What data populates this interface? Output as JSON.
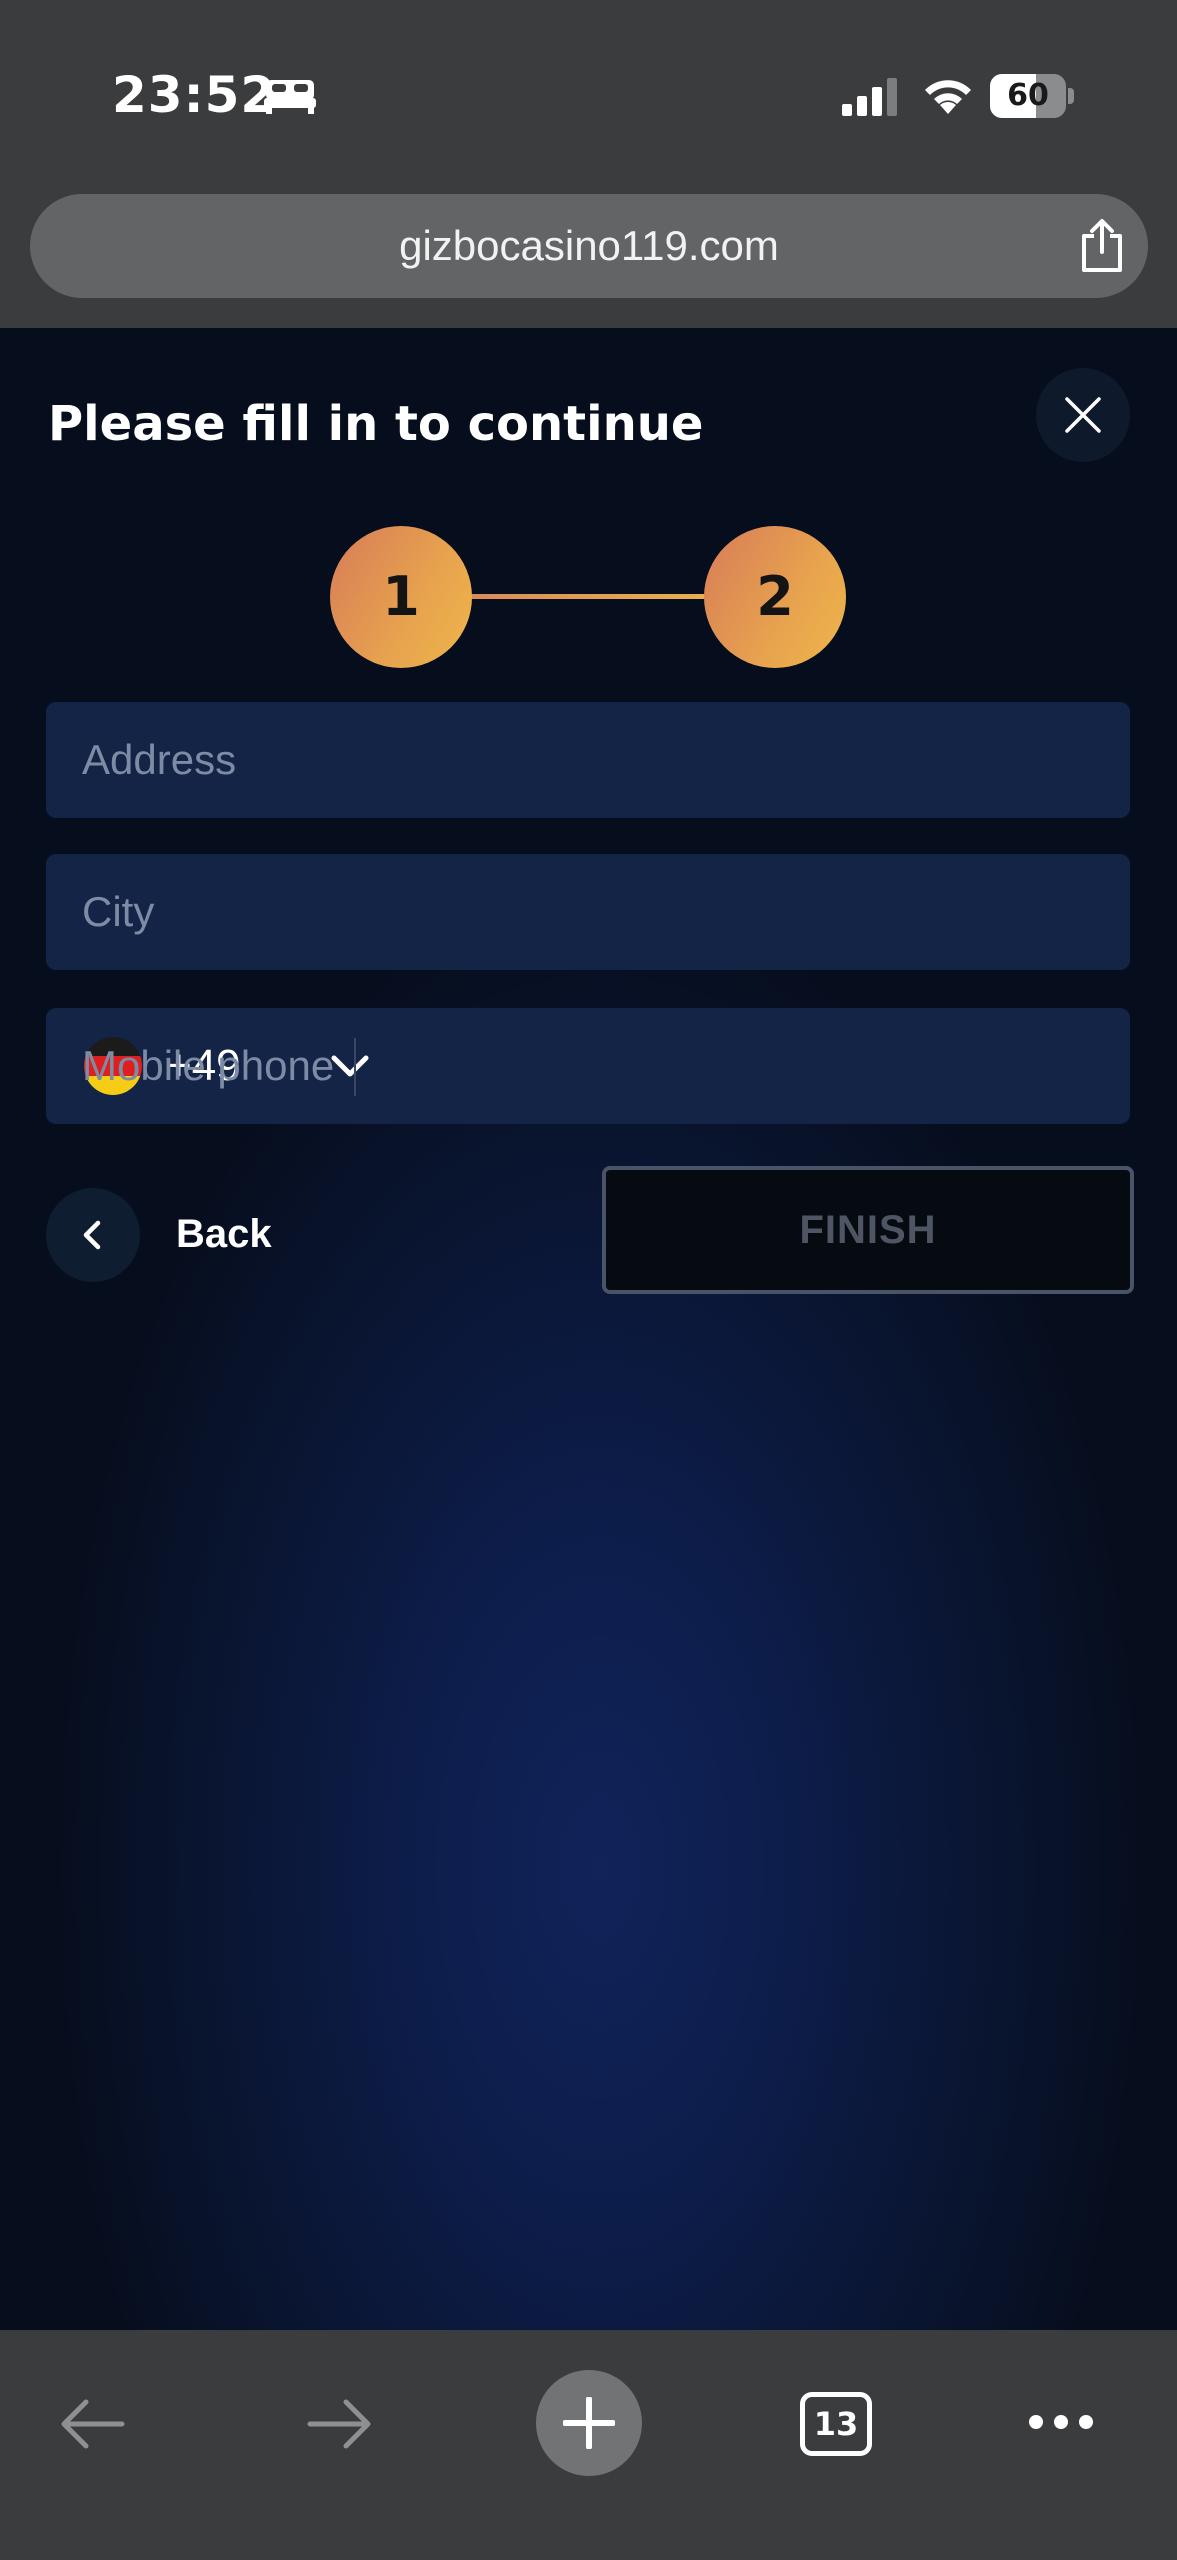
{
  "status_bar": {
    "time": "23:52",
    "battery_level": "60",
    "battery_fraction": 0.6,
    "icons": [
      "bed-icon",
      "signal-icon",
      "wifi-icon",
      "battery-icon"
    ]
  },
  "browser": {
    "url": "gizbocasino119.com",
    "tab_count": "13",
    "toolbar_icons": [
      "back-arrow-icon",
      "forward-arrow-icon",
      "plus-icon",
      "tabs-icon",
      "more-icon"
    ]
  },
  "modal": {
    "title": "Please fill in to continue",
    "steps": [
      "1",
      "2"
    ],
    "current_step": 2,
    "fields": {
      "address_placeholder": "Address",
      "city_placeholder": "City",
      "phone_code": "+49",
      "phone_placeholder": "Mobile phone",
      "country_flag": "germany-flag"
    },
    "back_label": "Back",
    "finish_label": "FINISH"
  },
  "colors": {
    "accent_gradient_start": "#d77c58",
    "accent_gradient_end": "#efb64a",
    "page_background": "#0a1634",
    "input_background": "#142446"
  }
}
